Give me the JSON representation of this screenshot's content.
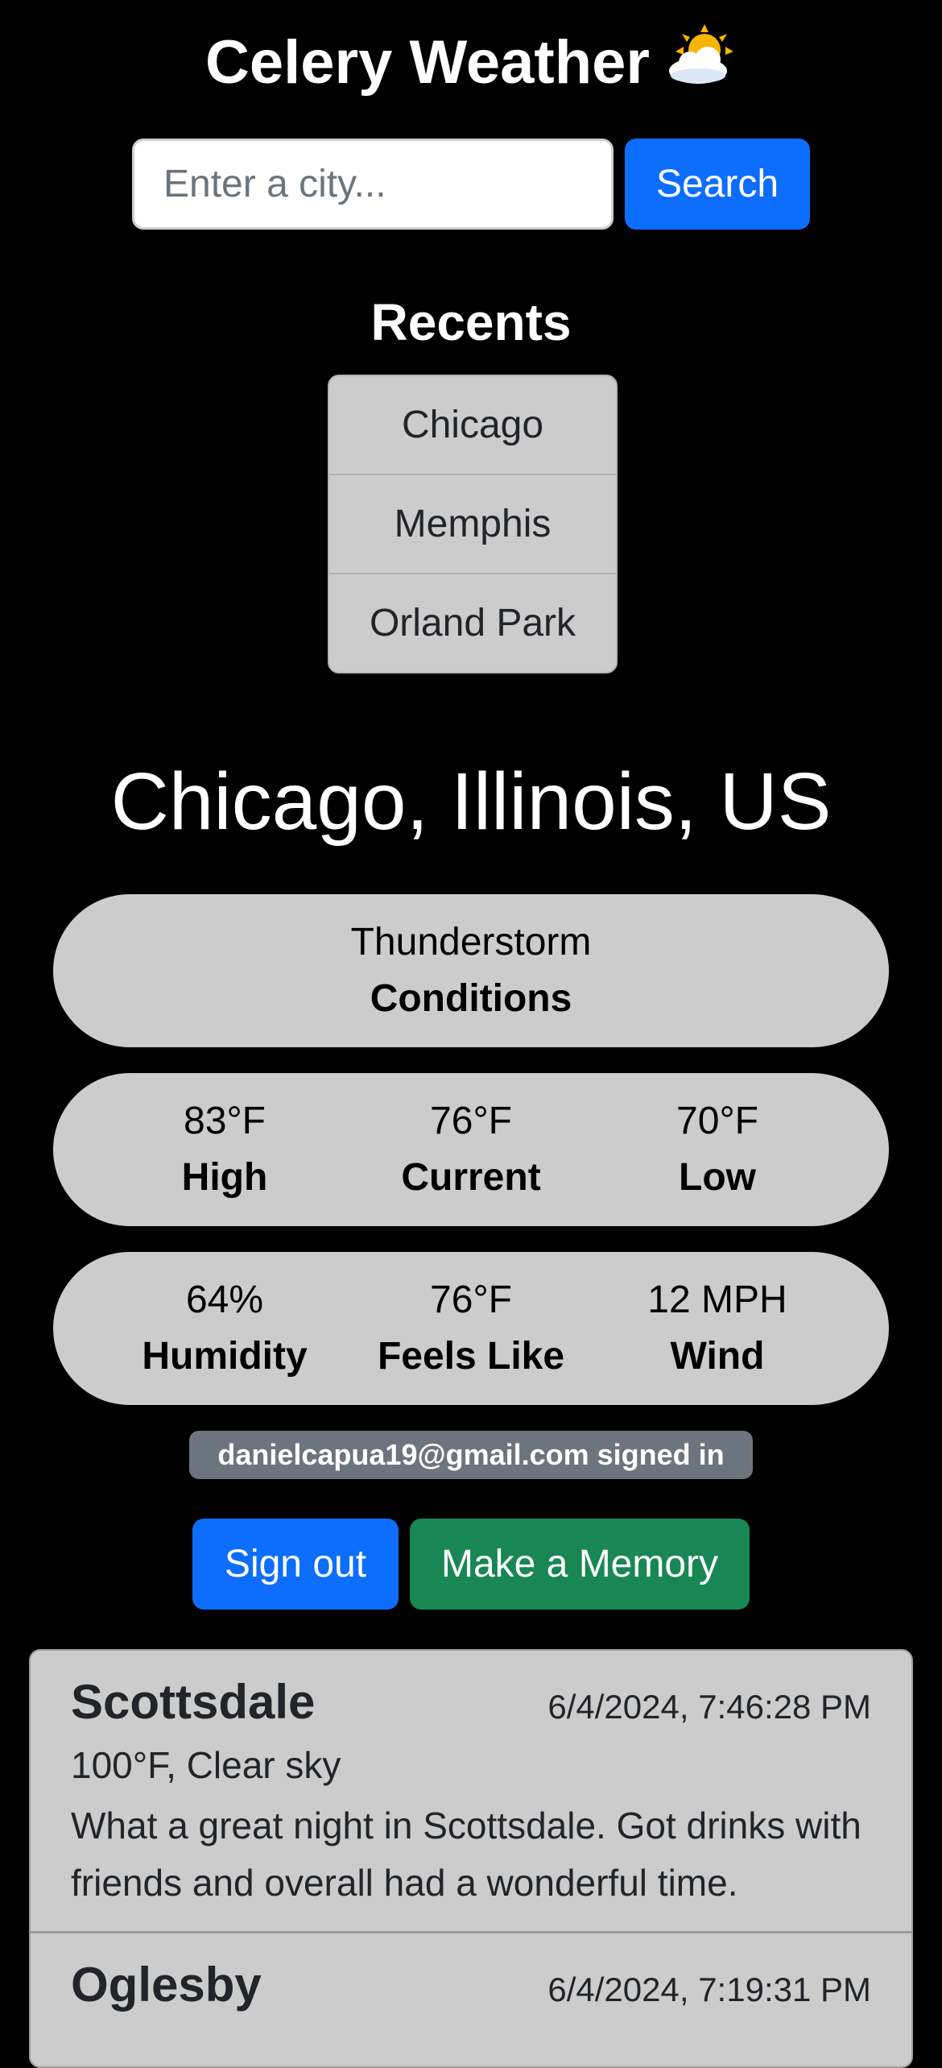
{
  "app": {
    "title": "Celery Weather",
    "title_icon": "sun-behind-cloud-icon"
  },
  "search": {
    "placeholder": "Enter a city...",
    "value": "",
    "button_label": "Search"
  },
  "recents": {
    "title": "Recents",
    "items": [
      "Chicago",
      "Memphis",
      "Orland Park"
    ]
  },
  "weather": {
    "location": "Chicago, Illinois, US",
    "conditions": {
      "value": "Thunderstorm",
      "label": "Conditions"
    },
    "high": {
      "value": "83°F",
      "label": "High"
    },
    "current": {
      "value": "76°F",
      "label": "Current"
    },
    "low": {
      "value": "70°F",
      "label": "Low"
    },
    "humidity": {
      "value": "64%",
      "label": "Humidity"
    },
    "feels_like": {
      "value": "76°F",
      "label": "Feels Like"
    },
    "wind": {
      "value": "12 MPH",
      "label": "Wind"
    }
  },
  "user": {
    "status": "danielcapua19@gmail.com signed in",
    "sign_out_label": "Sign out",
    "make_memory_label": "Make a Memory"
  },
  "memories": [
    {
      "city": "Scottsdale",
      "datetime": "6/4/2024, 7:46:28 PM",
      "weather": "100°F, Clear sky",
      "text": "What a great night in Scottsdale. Got drinks with friends and overall had a wonderful time."
    },
    {
      "city": "Oglesby",
      "datetime": "6/4/2024, 7:19:31 PM",
      "weather": "",
      "text": ""
    }
  ],
  "colors": {
    "background": "#000000",
    "primary": "#0d6efd",
    "success": "#198754",
    "secondary": "#6c757d",
    "panel": "#cccccc"
  }
}
